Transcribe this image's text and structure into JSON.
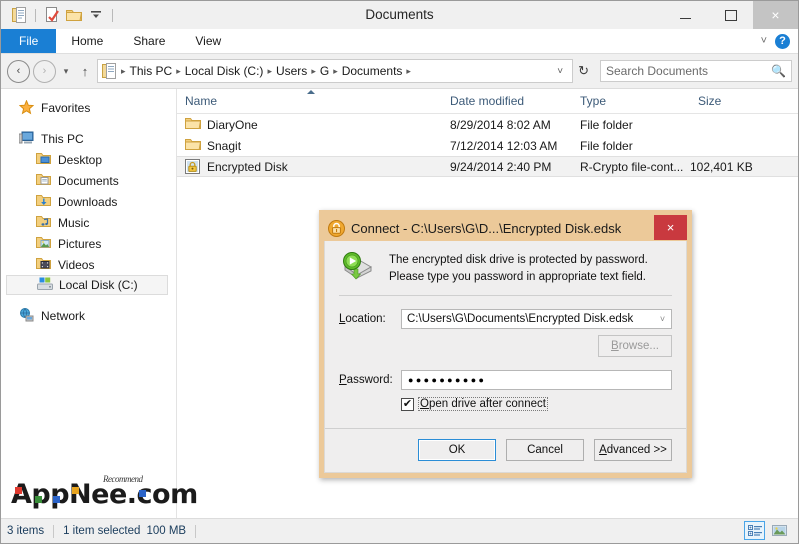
{
  "window": {
    "title": "Documents",
    "minimize_label": "Minimize",
    "maximize_label": "Maximize",
    "close_label": "×"
  },
  "quick_access": {
    "items": [
      {
        "name": "documents-icon",
        "label": "Documents"
      },
      {
        "name": "properties-icon",
        "label": "Properties"
      },
      {
        "name": "new-folder-icon",
        "label": "New folder"
      },
      {
        "name": "customize-icon",
        "label": "Customize Quick Access Toolbar"
      }
    ]
  },
  "ribbon": {
    "tabs": [
      {
        "label": "File",
        "active": true
      },
      {
        "label": "Home",
        "active": false
      },
      {
        "label": "Share",
        "active": false
      },
      {
        "label": "View",
        "active": false
      }
    ],
    "expand_label": "˅",
    "help_label": "?"
  },
  "address_bar": {
    "back_label": "‹",
    "forward_label": "›",
    "recent_label": "▾",
    "up_label": "↑",
    "breadcrumbs": [
      "This PC",
      "Local Disk (C:)",
      "Users",
      "G",
      "Documents"
    ],
    "separator": "▸",
    "dropdown_label": "˅",
    "refresh_label": "↻"
  },
  "search": {
    "placeholder": "Search Documents",
    "icon": "search-icon"
  },
  "sidebar": {
    "items": [
      {
        "label": "Favorites",
        "icon": "star-icon",
        "level": 0,
        "selected": false
      },
      {
        "label": "This PC",
        "icon": "computer-icon",
        "level": 0,
        "selected": false
      },
      {
        "label": "Desktop",
        "icon": "desktop-folder-icon",
        "level": 1,
        "selected": false
      },
      {
        "label": "Documents",
        "icon": "documents-folder-icon",
        "level": 1,
        "selected": false
      },
      {
        "label": "Downloads",
        "icon": "downloads-folder-icon",
        "level": 1,
        "selected": false
      },
      {
        "label": "Music",
        "icon": "music-folder-icon",
        "level": 1,
        "selected": false
      },
      {
        "label": "Pictures",
        "icon": "pictures-folder-icon",
        "level": 1,
        "selected": false
      },
      {
        "label": "Videos",
        "icon": "videos-folder-icon",
        "level": 1,
        "selected": false
      },
      {
        "label": "Local Disk (C:)",
        "icon": "drive-icon",
        "level": 1,
        "selected": true
      },
      {
        "label": "Network",
        "icon": "network-icon",
        "level": 0,
        "selected": false
      }
    ]
  },
  "file_list": {
    "columns": [
      {
        "label": "Name",
        "sorted": "asc"
      },
      {
        "label": "Date modified",
        "sorted": null
      },
      {
        "label": "Type",
        "sorted": null
      },
      {
        "label": "Size",
        "sorted": null
      }
    ],
    "rows": [
      {
        "name": "DiaryOne",
        "date": "8/29/2014 8:02 AM",
        "type": "File folder",
        "size": "",
        "icon": "folder-icon",
        "selected": false
      },
      {
        "name": "Snagit",
        "date": "7/12/2014 12:03 AM",
        "type": "File folder",
        "size": "",
        "icon": "folder-icon",
        "selected": false
      },
      {
        "name": "Encrypted Disk",
        "date": "9/24/2014 2:40 PM",
        "type": "R-Crypto file-cont...",
        "size": "102,401 KB",
        "icon": "encrypted-disk-icon",
        "selected": true
      }
    ]
  },
  "status_bar": {
    "item_count": "3 items",
    "selection": "1 item selected",
    "selection_size": "100 MB",
    "views": [
      {
        "name": "details-view-button",
        "active": true
      },
      {
        "name": "large-icons-view-button",
        "active": false
      }
    ]
  },
  "watermark": {
    "text": "AppNee.com",
    "superscript": "Recommend"
  },
  "dialog": {
    "title": "Connect - C:\\Users\\G\\D...\\Encrypted Disk.edsk",
    "title_icon": "lock-icon",
    "close_label": "×",
    "header_icon": "connect-disk-icon",
    "message_line1": "The encrypted disk drive is protected by password.",
    "message_line2": "Please type you password in appropriate text field.",
    "location_label": "Location:",
    "location_underline": "L",
    "location_value": "C:\\Users\\G\\Documents\\Encrypted Disk.edsk",
    "location_dropdown": "˅",
    "browse_label": "Browse...",
    "browse_underline": "B",
    "browse_enabled": false,
    "password_label": "Password:",
    "password_underline": "P",
    "password_value": "●●●●●●●●●●",
    "checkbox_label": "Open drive after connect",
    "checkbox_underline": "O",
    "checkbox_checked": true,
    "checkbox_mark": "✔",
    "ok_label": "OK",
    "cancel_label": "Cancel",
    "advanced_label": "Advanced >>",
    "advanced_underline": "A"
  },
  "colors": {
    "accent_blue": "#1a7fd4",
    "dialog_border": "#ecc999",
    "close_red": "#c9393f",
    "column_text": "#3c5a78",
    "status_text": "#1a3c5c"
  }
}
